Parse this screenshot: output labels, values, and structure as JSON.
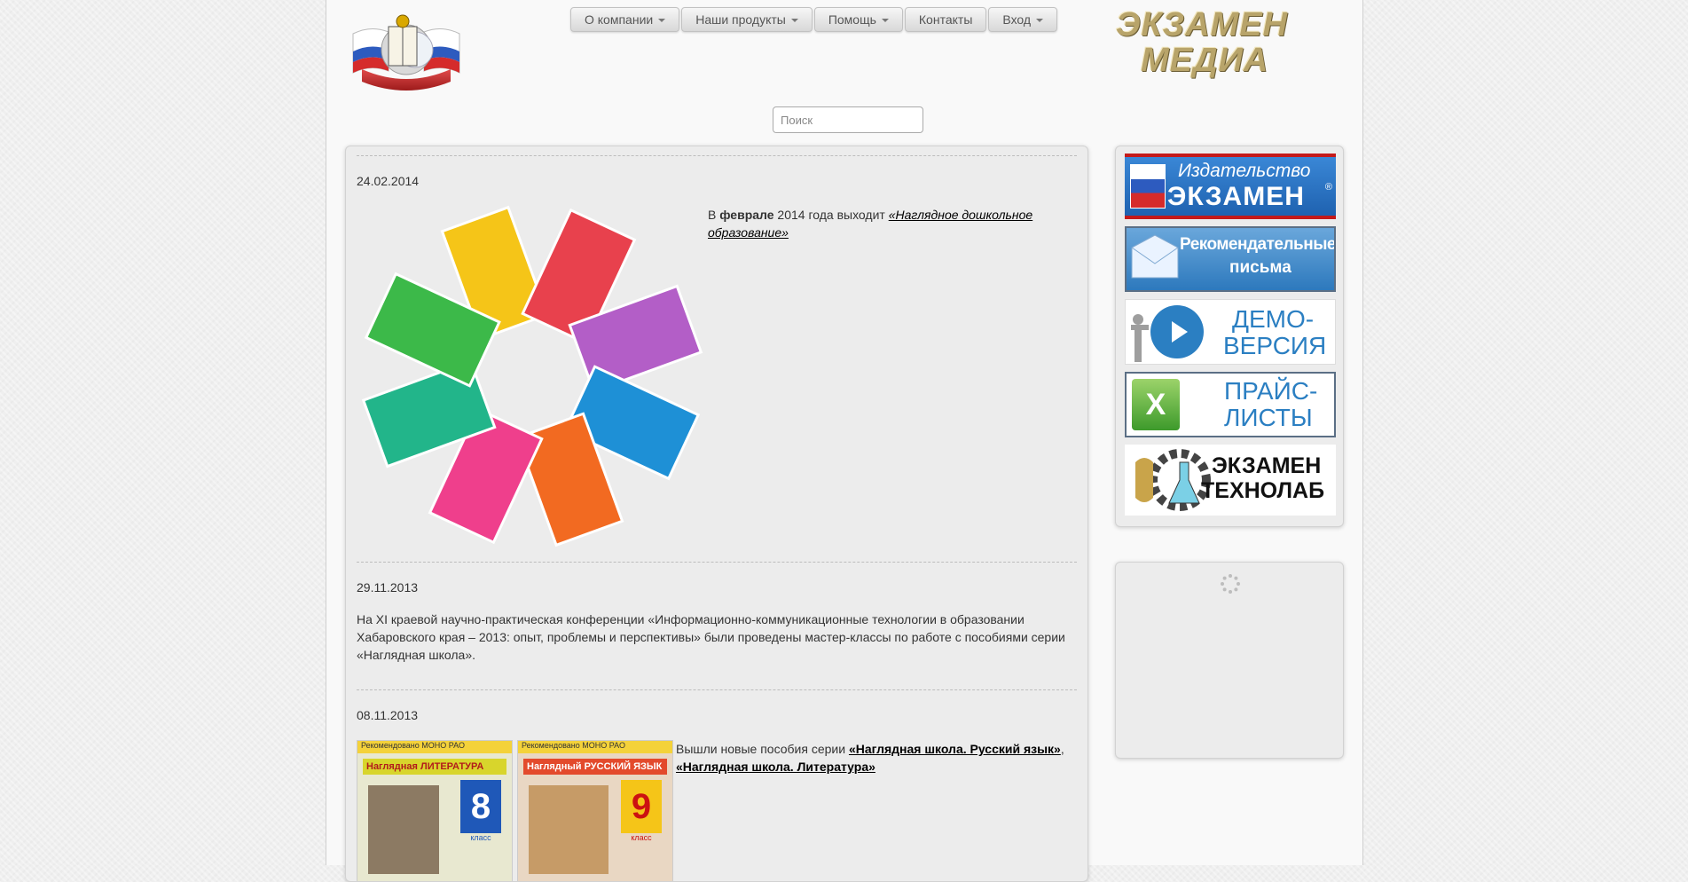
{
  "nav": {
    "items": [
      {
        "label": "О компании",
        "has_dropdown": true
      },
      {
        "label": "Наши продукты",
        "has_dropdown": true
      },
      {
        "label": "Помощь",
        "has_dropdown": true
      },
      {
        "label": "Контакты",
        "has_dropdown": false
      },
      {
        "label": "Вход",
        "has_dropdown": true
      }
    ]
  },
  "brand": {
    "line1": "ЭКЗАМЕН",
    "line2": "МЕДИА",
    "color": "#b8a46a"
  },
  "search": {
    "placeholder": "Поиск"
  },
  "news": [
    {
      "date": "24.02.2014",
      "text_pre": "В ",
      "text_bold": "феврале",
      "text_mid": " 2014 года выходит ",
      "link": "«Наглядное дошкольное образование»",
      "image_icon": "product-boxes-image"
    },
    {
      "date": "29.11.2013",
      "text": "На XI краевой научно-практическая конференции «Информационно-коммуникационные технологии в образовании Хабаровского края – 2013: опыт, проблемы и перспективы» были проведены мастер-классы по работе с пособиями серии «Наглядная школа»."
    },
    {
      "date": "08.11.2013",
      "text_pre": "Вышли новые пособия серии ",
      "link1": "«Наглядная школа. Русский язык»",
      "sep": ", ",
      "link2": "«Наглядная школа. Литература»",
      "covers": [
        {
          "badge": "Рекомендовано МОНО РАО",
          "title": "Наглядная ЛИТЕРАТУРА",
          "grade": "8",
          "grade_label": "класс"
        },
        {
          "badge": "Рекомендовано МОНО РАО",
          "title": "Наглядный РУССКИЙ ЯЗЫК",
          "grade": "9",
          "grade_label": "класс"
        }
      ]
    }
  ],
  "sidebar": {
    "banners": [
      {
        "line1": "Издательство",
        "line2": "ЭКЗАМЕН",
        "mark": "®",
        "icon": "russia-flag-emblem-icon"
      },
      {
        "line1": "Рекомендательные",
        "line2": "письма",
        "icon": "envelope-icon"
      },
      {
        "line1": "ДЕМО-",
        "line2": "ВЕРСИЯ",
        "icon": "play-presentation-icon"
      },
      {
        "line1": "ПРАЙС-",
        "line2": "ЛИСТЫ",
        "icon": "excel-icon"
      },
      {
        "line1": "ЭКЗАМЕН",
        "line2": "ТЕХНОЛАБ",
        "icon": "gear-flask-emblem-icon"
      }
    ]
  },
  "colors": {
    "accent_blue": "#2b7fc2",
    "banner_red": "#c41a1a"
  },
  "loading_widget": {
    "icon": "loading-spinner-icon"
  }
}
